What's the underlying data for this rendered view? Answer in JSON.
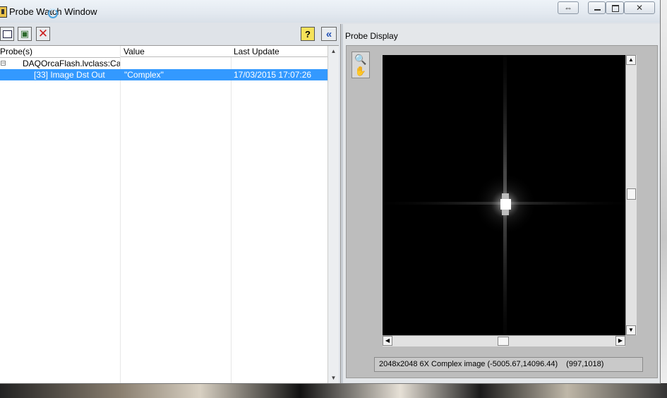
{
  "window": {
    "title": "Probe Watch Window",
    "controls": {
      "resize_icon": "double-arrow-icon",
      "minimize_icon": "minimize-icon",
      "maximize_icon": "maximize-icon",
      "close_icon": "close-icon",
      "close_label": "✕",
      "resize_label": "⇔"
    }
  },
  "toolbar": {
    "new_icon": "new-probe-icon",
    "tree_icon": "tree-view-icon",
    "delete_icon": "delete-icon",
    "delete_label": "✕",
    "help_label": "?",
    "collapse_label": "«"
  },
  "table": {
    "columns": [
      "Probe(s)",
      "Value",
      "Last Update"
    ],
    "parent_row": {
      "probe": "DAQOrcaFlash.lvclass:Calc"
    },
    "selected_row": {
      "probe": "[33] Image Dst Out",
      "value": "\"Complex\"",
      "last_update": "17/03/2015 17:07:26"
    },
    "expander_label": "−"
  },
  "probe_display": {
    "label": "Probe Display",
    "zoom_icon": "magnifier-icon",
    "pan_icon": "hand-icon",
    "status_text": "2048x2048 6X Complex image (-5005.67,14096.44)",
    "status_coords": "(997,1018)",
    "scroll": {
      "up": "▲",
      "down": "▼",
      "left": "◀",
      "right": "▶"
    }
  },
  "colors": {
    "selection": "#3399ff",
    "image_bg": "#000000"
  }
}
